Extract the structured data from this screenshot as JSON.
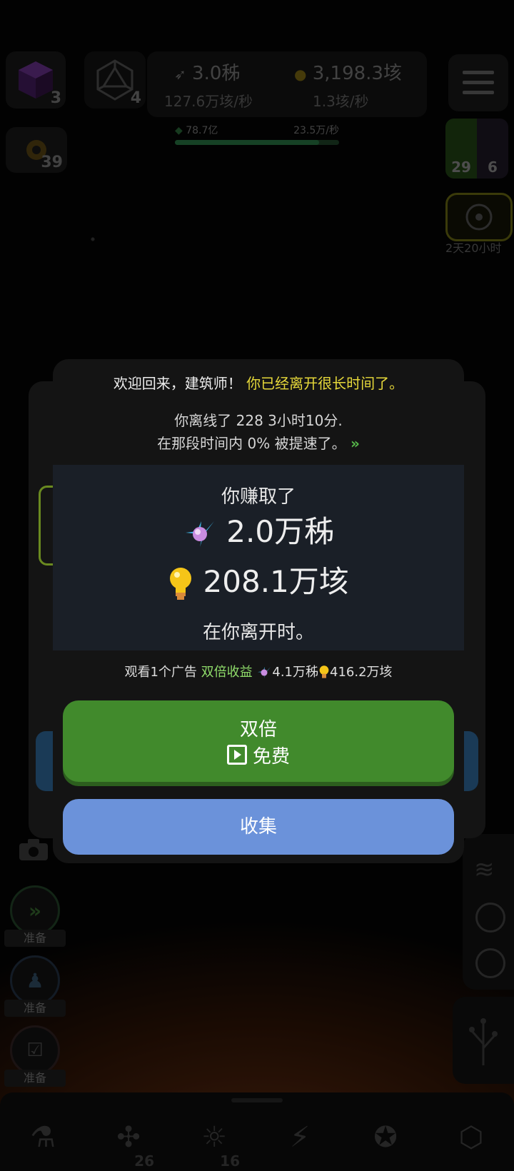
{
  "hud": {
    "cube_count": "3",
    "d20_count": "4",
    "gear_count": "39",
    "resource1_value": "3.0秭",
    "resource1_rate": "127.6万垓/秒",
    "resource2_value": "3,198.3垓",
    "resource2_rate": "1.3垓/秒",
    "progress_left": "78.7亿",
    "progress_right": "23.5万/秒",
    "progress_fraction": 0.88,
    "right_top_count_a": "29",
    "right_top_count_b": "6",
    "timer": "2天20小时"
  },
  "side": {
    "ready1": "准备",
    "ready2": "准备",
    "ready3": "准备"
  },
  "modal": {
    "welcome": "欢迎回来，建筑师！",
    "welcome_highlight": "你已经离开很长时间了。",
    "offline_line1": "你离线了 228 3小时10分.",
    "offline_line2": "在那段时间内 0% 被提速了。",
    "earn_title": "你赚取了",
    "earn_amount1": "2.0万秭",
    "earn_amount2": "208.1万垓",
    "earn_foot": "在你离开时。",
    "ad_prefix": "观看1个广告",
    "ad_double": "双倍收益",
    "ad_amount1": "4.1万秭",
    "ad_amount2": "416.2万垓",
    "double_title": "双倍",
    "double_free": "免费",
    "collect": "收集"
  },
  "bottom_nav": {
    "dna_count": "26",
    "idea_count": "16"
  },
  "colors": {
    "green_button": "#418a2c",
    "blue_button": "#6b92da",
    "highlight_yellow": "#e6d83a",
    "highlight_green": "#8fdc6a"
  }
}
